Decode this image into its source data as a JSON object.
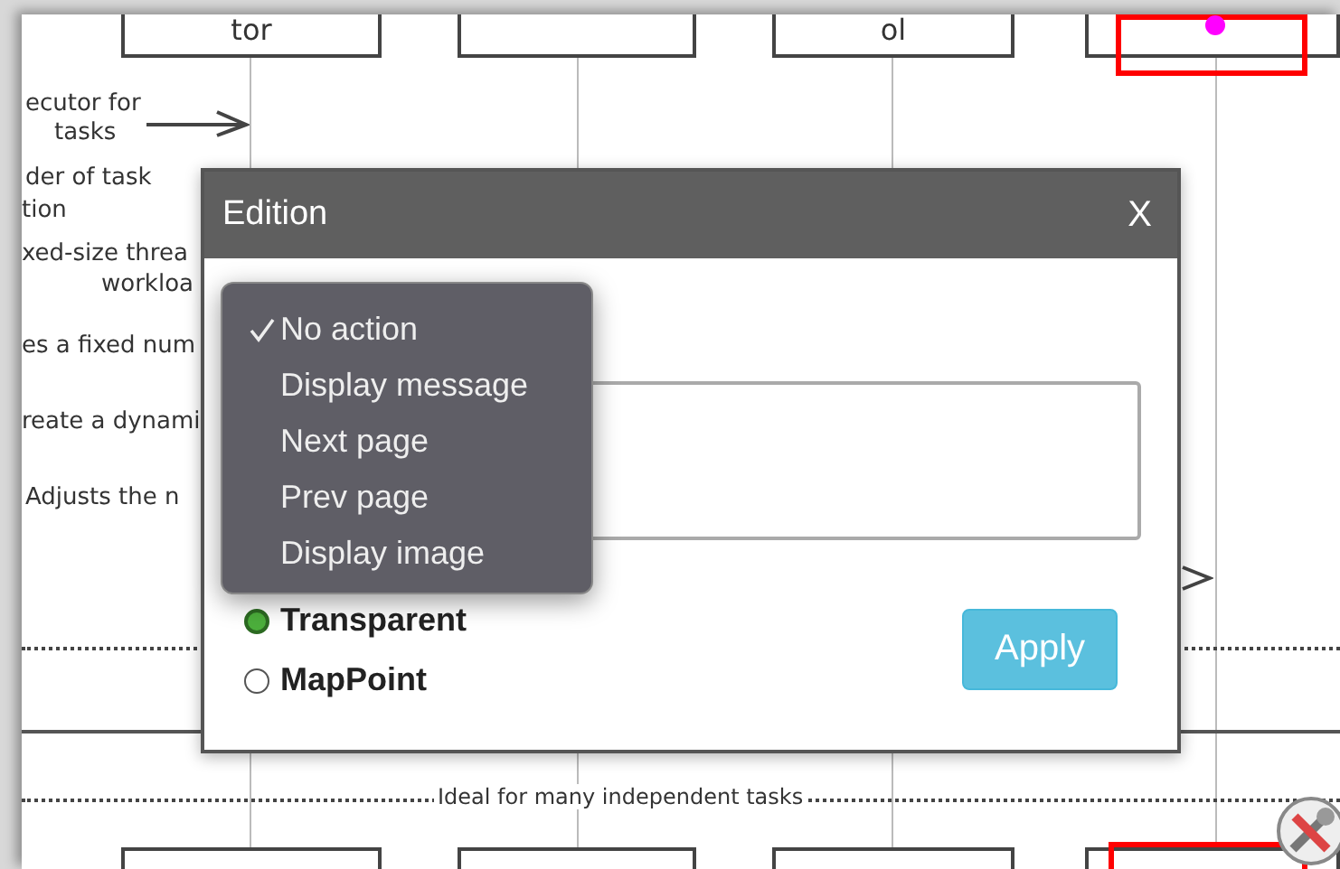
{
  "diagram": {
    "participants": [
      {
        "label": "tor",
        "selected": false
      },
      {
        "selected": false
      },
      {
        "label": "ol",
        "selected": false
      },
      {
        "selected": true
      }
    ],
    "notes": [
      "ecutor for",
      "tasks",
      "der of task",
      "tion",
      "xed-size threa",
      "workloa",
      "es a fixed num",
      "reate a dynami",
      "Adjusts the n"
    ],
    "separator": "Ideal for many independent tasks"
  },
  "dialog": {
    "title": "Edition",
    "close": "X",
    "action_menu": [
      {
        "label": "No action",
        "selected": true
      },
      {
        "label": "Display message",
        "selected": false
      },
      {
        "label": "Next page",
        "selected": false
      },
      {
        "label": "Prev page",
        "selected": false
      },
      {
        "label": "Display image",
        "selected": false
      }
    ],
    "modes": [
      {
        "label": "Transparent",
        "selected": true
      },
      {
        "label": "MapPoint",
        "selected": false
      }
    ],
    "apply": "Apply"
  }
}
